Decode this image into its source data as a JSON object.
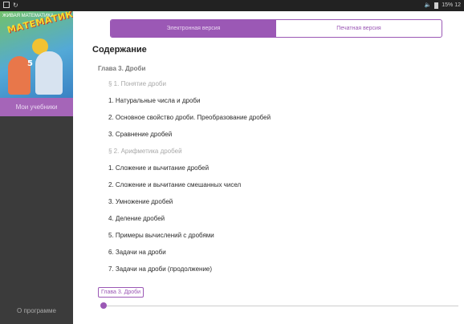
{
  "status_bar": {
    "icons": [
      "image-icon",
      "sync-icon",
      "volume-icon",
      "battery-icon"
    ],
    "right_text": "15%  12"
  },
  "sidebar": {
    "cover": {
      "series": "ЖИВАЯ МАТЕМАТИКА",
      "title": "МАТЕМАТИКА",
      "grade": "5"
    },
    "active_item": "Мои учебники",
    "footer_item": "О программе"
  },
  "tabs": {
    "electronic": "Электронная версия",
    "print": "Печатная версия"
  },
  "content": {
    "heading": "Содержание",
    "chapter": "Глава 3. Дроби",
    "items": [
      {
        "kind": "section",
        "text": "§ 1. Понятие дроби"
      },
      {
        "kind": "item",
        "text": "1. Натуральные числа и дроби"
      },
      {
        "kind": "item",
        "text": "2. Основное свойство дроби. Преобразование дробей"
      },
      {
        "kind": "item",
        "text": "3. Сравнение дробей"
      },
      {
        "kind": "section",
        "text": "§ 2. Арифметика дробей"
      },
      {
        "kind": "item",
        "text": "1. Сложение и вычитание дробей"
      },
      {
        "kind": "item",
        "text": "2. Сложение и вычитание смешанных чисел"
      },
      {
        "kind": "item",
        "text": "3. Умножение дробей"
      },
      {
        "kind": "item",
        "text": "4. Деление дробей"
      },
      {
        "kind": "item",
        "text": "5. Примеры вычислений с дробями"
      },
      {
        "kind": "item",
        "text": "6. Задачи на дроби"
      },
      {
        "kind": "item",
        "text": "7. Задачи на дроби (продолжение)"
      }
    ]
  },
  "reader": {
    "chapter_chip": "Глава 3. Дроби",
    "progress_fraction": 0.0
  },
  "colors": {
    "accent": "#9b58b5",
    "sidebar": "#3b3b3b",
    "statusbar": "#222222"
  }
}
